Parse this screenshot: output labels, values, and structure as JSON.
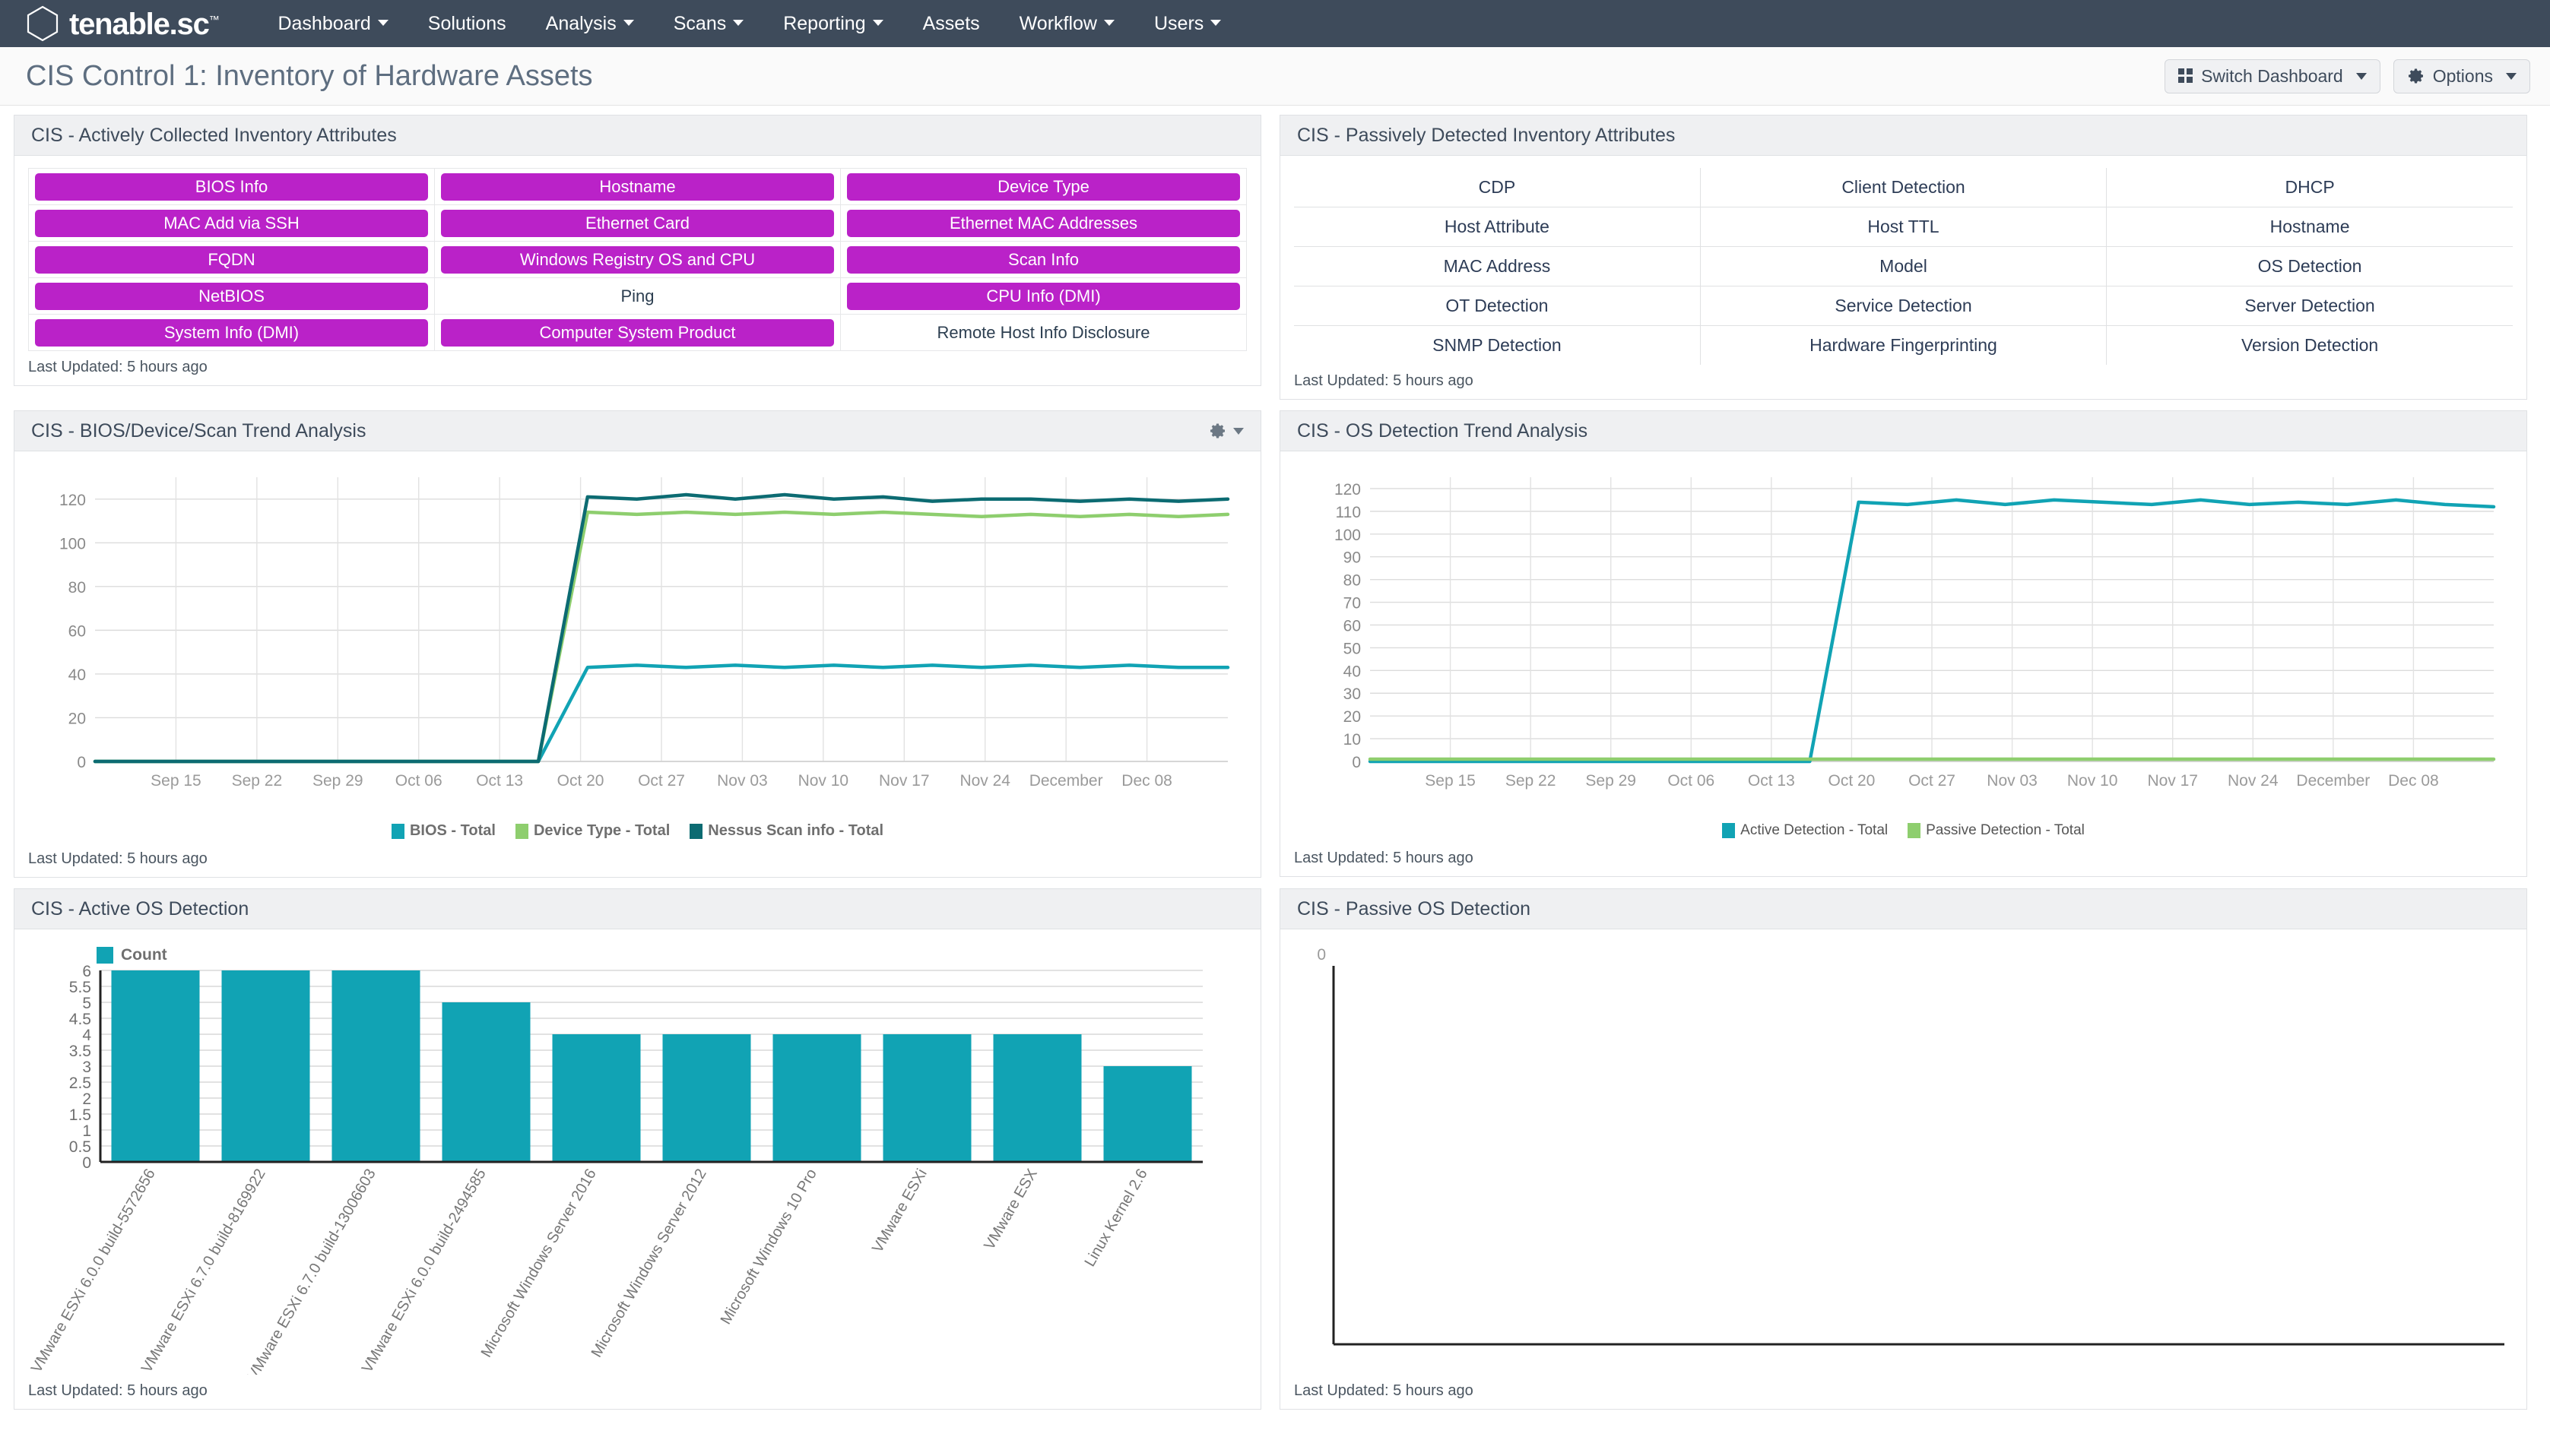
{
  "nav": {
    "brand": "tenable.sc",
    "brand_tm": "™",
    "items": [
      {
        "label": "Dashboard",
        "caret": true
      },
      {
        "label": "Solutions",
        "caret": false
      },
      {
        "label": "Analysis",
        "caret": true
      },
      {
        "label": "Scans",
        "caret": true
      },
      {
        "label": "Reporting",
        "caret": true
      },
      {
        "label": "Assets",
        "caret": false
      },
      {
        "label": "Workflow",
        "caret": true
      },
      {
        "label": "Users",
        "caret": true
      }
    ]
  },
  "header": {
    "title": "CIS Control 1: Inventory of Hardware Assets",
    "switch_dashboard": "Switch Dashboard",
    "options": "Options"
  },
  "panels": {
    "active_attrs": {
      "title": "CIS - Actively Collected Inventory Attributes",
      "footer": "Last Updated: 5 hours ago",
      "rows": [
        [
          {
            "label": "BIOS Info",
            "active": true
          },
          {
            "label": "Hostname",
            "active": true
          },
          {
            "label": "Device Type",
            "active": true
          }
        ],
        [
          {
            "label": "MAC Add via SSH",
            "active": true
          },
          {
            "label": "Ethernet Card",
            "active": true
          },
          {
            "label": "Ethernet MAC Addresses",
            "active": true
          }
        ],
        [
          {
            "label": "FQDN",
            "active": true
          },
          {
            "label": "Windows Registry OS and CPU",
            "active": true
          },
          {
            "label": "Scan Info",
            "active": true
          }
        ],
        [
          {
            "label": "NetBIOS",
            "active": true
          },
          {
            "label": "Ping",
            "active": false
          },
          {
            "label": "CPU Info (DMI)",
            "active": true
          }
        ],
        [
          {
            "label": "System Info (DMI)",
            "active": true
          },
          {
            "label": "Computer System Product",
            "active": true
          },
          {
            "label": "Remote Host Info Disclosure",
            "active": false
          }
        ]
      ]
    },
    "passive_attrs": {
      "title": "CIS - Passively Detected Inventory Attributes",
      "footer": "Last Updated: 5 hours ago",
      "rows": [
        [
          "CDP",
          "Client Detection",
          "DHCP"
        ],
        [
          "Host Attribute",
          "Host TTL",
          "Hostname"
        ],
        [
          "MAC Address",
          "Model",
          "OS Detection"
        ],
        [
          "OT Detection",
          "Service Detection",
          "Server Detection"
        ],
        [
          "SNMP Detection",
          "Hardware Fingerprinting",
          "Version Detection"
        ]
      ]
    },
    "bios_trend": {
      "title": "CIS - BIOS/Device/Scan Trend Analysis",
      "footer": "Last Updated: 5 hours ago",
      "has_gear": true
    },
    "os_trend": {
      "title": "CIS - OS Detection Trend Analysis",
      "footer": "Last Updated: 5 hours ago",
      "has_gear": false
    },
    "active_os": {
      "title": "CIS - Active OS Detection",
      "footer": "Last Updated: 5 hours ago"
    },
    "passive_os": {
      "title": "CIS - Passive OS Detection",
      "footer": "Last Updated: 5 hours ago"
    }
  },
  "colors": {
    "accent_purple": "#ba22c8",
    "teal": "#11a3b4",
    "dark_teal": "#0c6b72",
    "green": "#8ece6e",
    "navy": "#3e4b5b"
  },
  "chart_data": [
    {
      "id": "bios-trend",
      "type": "line",
      "title": "CIS - BIOS/Device/Scan Trend Analysis",
      "xlabel": "",
      "ylabel": "",
      "ylim": [
        0,
        130
      ],
      "yticks": [
        0,
        20,
        40,
        60,
        80,
        100,
        120
      ],
      "grid": true,
      "legend_position": "bottom",
      "xtick_labels": [
        "Sep 15",
        "Sep 22",
        "Sep 29",
        "Oct 06",
        "Oct 13",
        "Oct 20",
        "Oct 27",
        "Nov 03",
        "Nov 10",
        "Nov 17",
        "Nov 24",
        "December",
        "Dec 08"
      ],
      "x": [
        "Sep 08",
        "Sep 15",
        "Sep 22",
        "Sep 29",
        "Oct 06",
        "Oct 13",
        "Oct 20",
        "Oct 27",
        "Nov 03",
        "Nov 08",
        "Nov 10",
        "Nov 12",
        "Nov 14",
        "Nov 17",
        "Nov 19",
        "Nov 21",
        "Nov 24",
        "Nov 26",
        "Nov 28",
        "December",
        "Dec 03",
        "Dec 05",
        "Dec 08",
        "Dec 10"
      ],
      "series": [
        {
          "name": "BIOS - Total",
          "color": "#11a3b4",
          "values": [
            0,
            0,
            0,
            0,
            0,
            0,
            0,
            0,
            0,
            0,
            43,
            44,
            43,
            44,
            43,
            44,
            43,
            44,
            43,
            44,
            43,
            44,
            43,
            43
          ]
        },
        {
          "name": "Device Type - Total",
          "color": "#8ece6e",
          "values": [
            0,
            0,
            0,
            0,
            0,
            0,
            0,
            0,
            0,
            0,
            114,
            113,
            114,
            113,
            114,
            113,
            114,
            113,
            112,
            113,
            112,
            113,
            112,
            113
          ]
        },
        {
          "name": "Nessus Scan info - Total",
          "color": "#0c6b72",
          "values": [
            0,
            0,
            0,
            0,
            0,
            0,
            0,
            0,
            0,
            0,
            121,
            120,
            122,
            120,
            122,
            120,
            121,
            119,
            120,
            120,
            119,
            120,
            119,
            120
          ]
        }
      ]
    },
    {
      "id": "os-trend",
      "type": "line",
      "title": "CIS - OS Detection Trend Analysis",
      "xlabel": "",
      "ylabel": "",
      "ylim": [
        0,
        125
      ],
      "yticks": [
        0,
        10,
        20,
        30,
        40,
        50,
        60,
        70,
        80,
        90,
        100,
        110,
        120
      ],
      "grid": true,
      "legend_position": "bottom",
      "xtick_labels": [
        "Sep 15",
        "Sep 22",
        "Sep 29",
        "Oct 06",
        "Oct 13",
        "Oct 20",
        "Oct 27",
        "Nov 03",
        "Nov 10",
        "Nov 17",
        "Nov 24",
        "December",
        "Dec 08"
      ],
      "x": [
        "Sep 08",
        "Sep 15",
        "Sep 22",
        "Sep 29",
        "Oct 06",
        "Oct 13",
        "Oct 20",
        "Oct 27",
        "Nov 03",
        "Nov 08",
        "Nov 10",
        "Nov 12",
        "Nov 14",
        "Nov 17",
        "Nov 19",
        "Nov 21",
        "Nov 24",
        "Nov 26",
        "Nov 28",
        "December",
        "Dec 03",
        "Dec 05",
        "Dec 08",
        "Dec 10"
      ],
      "series": [
        {
          "name": "Active Detection - Total",
          "color": "#11a3b4",
          "values": [
            0,
            0,
            0,
            0,
            0,
            0,
            0,
            0,
            0,
            0,
            114,
            113,
            115,
            113,
            115,
            114,
            113,
            115,
            113,
            114,
            113,
            115,
            113,
            112
          ]
        },
        {
          "name": "Passive Detection - Total",
          "color": "#8ece6e",
          "values": [
            1,
            1,
            1,
            1,
            1,
            1,
            1,
            1,
            1,
            1,
            1,
            1,
            1,
            1,
            1,
            1,
            1,
            1,
            1,
            1,
            1,
            1,
            1,
            1
          ]
        }
      ]
    },
    {
      "id": "active-os-detection",
      "type": "bar",
      "title": "CIS - Active OS Detection",
      "xlabel": "",
      "ylabel": "",
      "ylim": [
        0,
        6
      ],
      "yticks": [
        0,
        0.5,
        1,
        1.5,
        2,
        2.5,
        3,
        3.5,
        4,
        4.5,
        5,
        5.5,
        6
      ],
      "grid": true,
      "legend_position": "top-left",
      "legend_entries": [
        "Count"
      ],
      "bar_color": "#11a3b4",
      "categories": [
        "VMware ESXi 6.0.0 build-5572656",
        "VMware ESXi 6.7.0 build-8169922",
        "VMware ESXi 6.7.0 build-13006603",
        "VMware ESXi 6.0.0 build-2494585",
        "Microsoft Windows Server 2016",
        "Microsoft Windows Server 2012",
        "Microsoft Windows 10 Pro",
        "VMware ESXi",
        "VMware ESX",
        "Linux Kernel 2.6"
      ],
      "values": [
        6,
        6,
        6,
        5,
        4,
        4,
        4,
        4,
        4,
        3
      ]
    },
    {
      "id": "passive-os-detection",
      "type": "bar",
      "title": "CIS - Passive OS Detection",
      "xlabel": "",
      "ylabel": "",
      "ylim": [
        0,
        0
      ],
      "yticks": [
        0
      ],
      "grid": false,
      "categories": [],
      "values": []
    }
  ]
}
